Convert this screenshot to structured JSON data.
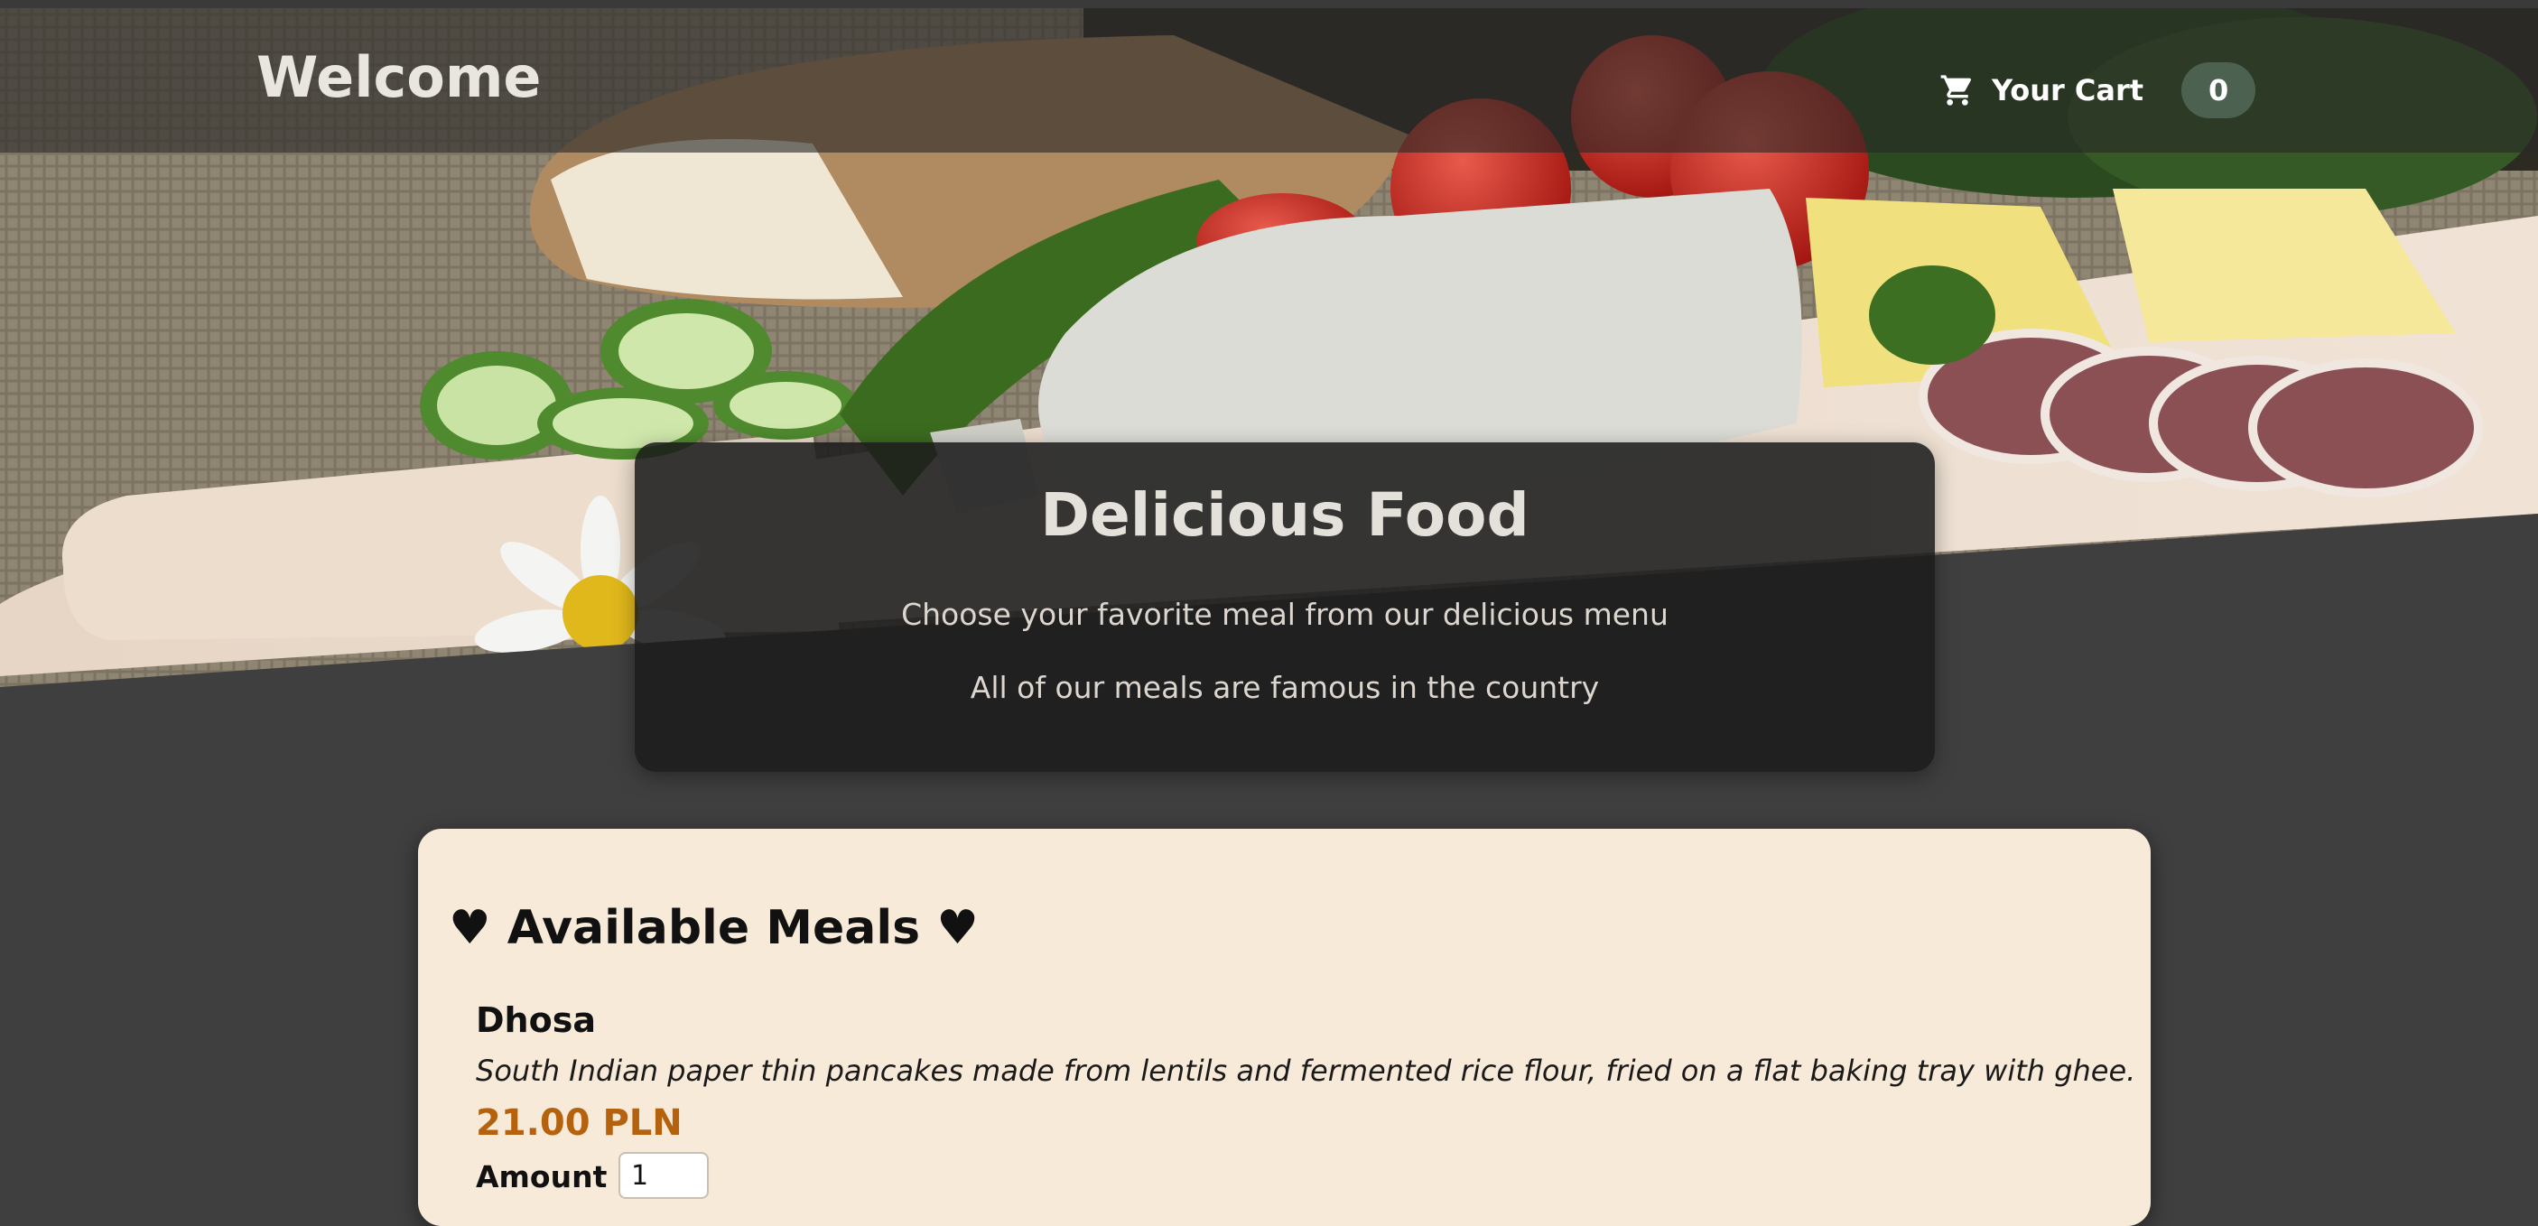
{
  "header": {
    "title": "Welcome",
    "cart_label": "Your Cart",
    "cart_count": "0"
  },
  "summary": {
    "title": "Delicious Food",
    "line1": "Choose your favorite meal from our delicious menu",
    "line2": "All of our meals are famous in the country"
  },
  "meals": {
    "heading": "♥ Available Meals ♥",
    "items": [
      {
        "name": "Dhosa",
        "description": "South Indian paper thin pancakes made from lentils and fermented rice flour, fried on a flat baking tray with ghee.",
        "price": "21.00 PLN",
        "amount_label": "Amount",
        "amount_value": "1"
      }
    ]
  },
  "colors": {
    "page_bg": "#3f3f3f",
    "header_bg": "rgba(40,40,38,0.62)",
    "cart_badge": "#4c6150",
    "meals_bg": "#f8ead9",
    "price": "#b5620f"
  },
  "icons": {
    "cart": "cart-icon"
  }
}
